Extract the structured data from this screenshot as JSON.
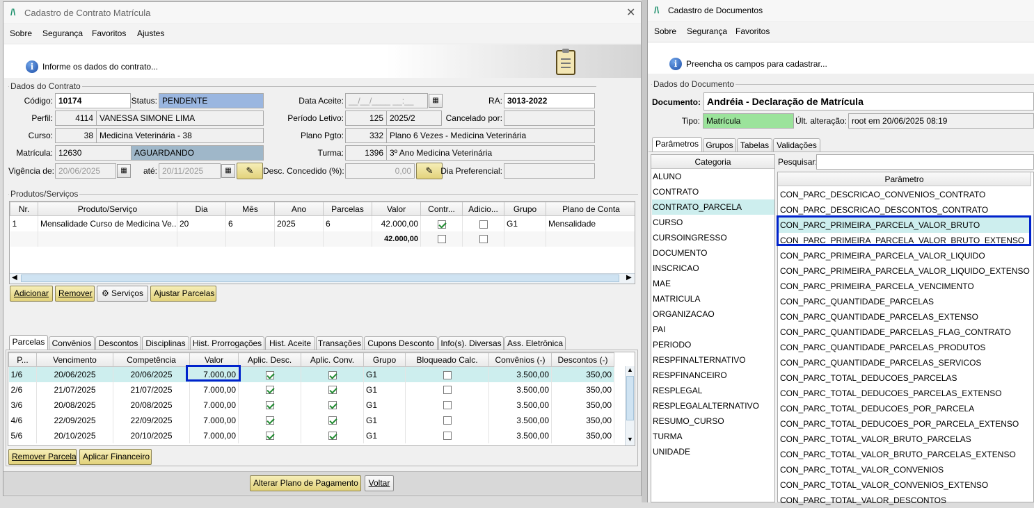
{
  "left_window": {
    "title": "Cadastro de Contrato Matrícula",
    "menu": [
      "Sobre",
      "Segurança",
      "Favoritos",
      "Ajustes"
    ],
    "info_text": "Informe os dados do contrato...",
    "section_contract": "Dados do Contrato",
    "labels": {
      "codigo": "Código:",
      "status": "Status:",
      "data_aceite": "Data Aceite:",
      "ra": "RA:",
      "perfil": "Perfil:",
      "periodo": "Período Letivo:",
      "cancelado": "Cancelado por:",
      "curso": "Curso:",
      "plano": "Plano Pgto:",
      "matricula": "Matrícula:",
      "turma": "Turma:",
      "vigencia": "Vigência de:",
      "ate": "até:",
      "desc": "Desc. Concedido (%):",
      "dia_pref": "Dia Preferencial:"
    },
    "values": {
      "codigo": "10174",
      "status": "PENDENTE",
      "data_aceite": "__/__/____ __:__",
      "ra": "3013-2022",
      "perfil_id": "4114",
      "perfil_nome": "VANESSA SIMONE LIMA",
      "periodo_id": "125",
      "periodo_nome": "2025/2",
      "cancelado": "",
      "curso_id": "38",
      "curso_nome": "Medicina Veterinária - 38",
      "plano_id": "332",
      "plano_nome": "Plano 6 Vezes - Medicina Veterinária",
      "matricula_id": "12630",
      "matricula_status": "AGUARDANDO",
      "turma_id": "1396",
      "turma_nome": "3º Ano Medicina Veterinária",
      "vigencia_de": "20/06/2025",
      "vigencia_ate": "20/11/2025",
      "desc": "0,00",
      "dia_pref": ""
    },
    "section_products": "Produtos/Serviços",
    "products_headers": [
      "Nr.",
      "Produto/Serviço",
      "Dia",
      "Mês",
      "Ano",
      "Parcelas",
      "Valor",
      "Contr...",
      "Adicio...",
      "Grupo",
      "Plano de Conta"
    ],
    "products_rows": [
      {
        "nr": "1",
        "produto": "Mensalidade Curso de Medicina Ve...",
        "dia": "20",
        "mes": "6",
        "ano": "2025",
        "parcelas": "6",
        "valor": "42.000,00",
        "contr": true,
        "adic": false,
        "grupo": "G1",
        "plano": "Mensalidade"
      }
    ],
    "products_total": "42.000,00",
    "product_buttons": [
      "Adicionar",
      "Remover",
      "Serviços",
      "Ajustar Parcelas"
    ],
    "tabs": [
      "Parcelas",
      "Convênios",
      "Descontos",
      "Disciplinas",
      "Hist. Prorrogações",
      "Hist. Aceite",
      "Transações",
      "Cupons Desconto",
      "Info(s). Diversas",
      "Ass. Eletrônica"
    ],
    "parcel_headers": [
      "P...",
      "Vencimento",
      "Competência",
      "Valor",
      "Aplic. Desc.",
      "Aplic. Conv.",
      "Grupo",
      "Bloqueado Calc.",
      "Convênios (-)",
      "Descontos (-)"
    ],
    "parcel_rows": [
      {
        "p": "1/6",
        "venc": "20/06/2025",
        "comp": "20/06/2025",
        "valor": "7.000,00",
        "desc": true,
        "conv": true,
        "grupo": "G1",
        "bloq": false,
        "convenios": "3.500,00",
        "descontos": "350,00"
      },
      {
        "p": "2/6",
        "venc": "21/07/2025",
        "comp": "21/07/2025",
        "valor": "7.000,00",
        "desc": true,
        "conv": true,
        "grupo": "G1",
        "bloq": false,
        "convenios": "3.500,00",
        "descontos": "350,00"
      },
      {
        "p": "3/6",
        "venc": "20/08/2025",
        "comp": "20/08/2025",
        "valor": "7.000,00",
        "desc": true,
        "conv": true,
        "grupo": "G1",
        "bloq": false,
        "convenios": "3.500,00",
        "descontos": "350,00"
      },
      {
        "p": "4/6",
        "venc": "22/09/2025",
        "comp": "22/09/2025",
        "valor": "7.000,00",
        "desc": true,
        "conv": true,
        "grupo": "G1",
        "bloq": false,
        "convenios": "3.500,00",
        "descontos": "350,00"
      },
      {
        "p": "5/6",
        "venc": "20/10/2025",
        "comp": "20/10/2025",
        "valor": "7.000,00",
        "desc": true,
        "conv": true,
        "grupo": "G1",
        "bloq": false,
        "convenios": "3.500,00",
        "descontos": "350,00"
      }
    ],
    "parcel_buttons": [
      "Remover Parcela",
      "Aplicar Financeiro"
    ],
    "footer_buttons": [
      "Alterar Plano de Pagamento",
      "Voltar"
    ]
  },
  "right_window": {
    "title": "Cadastro de Documentos",
    "menu": [
      "Sobre",
      "Segurança",
      "Favoritos"
    ],
    "info_text": "Preencha os campos para cadastrar...",
    "section": "Dados do Documento",
    "documento_label": "Documento:",
    "documento_value": "Andréia - Declaração de Matrícula",
    "tipo_label": "Tipo:",
    "tipo_value": "Matrícula",
    "ult_label": "Últ. alteração:",
    "ult_value": "root em 20/06/2025 08:19",
    "tabs": [
      "Parâmetros",
      "Grupos",
      "Tabelas",
      "Validações"
    ],
    "categoria_header": "Categoria",
    "pesquisar_label": "Pesquisar:",
    "parametro_header": "Parâmetro",
    "categories": [
      "ALUNO",
      "CONTRATO",
      "CONTRATO_PARCELA",
      "CURSO",
      "CURSOINGRESSO",
      "DOCUMENTO",
      "INSCRICAO",
      "MAE",
      "MATRICULA",
      "ORGANIZACAO",
      "PAI",
      "PERIODO",
      "RESPFINALTERNATIVO",
      "RESPFINANCEIRO",
      "RESPLEGAL",
      "RESPLEGALALTERNATIVO",
      "RESUMO_CURSO",
      "TURMA",
      "UNIDADE"
    ],
    "selected_category": "CONTRATO_PARCELA",
    "parameters": [
      "CON_PARC_DESCRICAO_CONVENIOS_CONTRATO",
      "CON_PARC_DESCRICAO_DESCONTOS_CONTRATO",
      "CON_PARC_PRIMEIRA_PARCELA_VALOR_BRUTO",
      "CON_PARC_PRIMEIRA_PARCELA_VALOR_BRUTO_EXTENSO",
      "CON_PARC_PRIMEIRA_PARCELA_VALOR_LIQUIDO",
      "CON_PARC_PRIMEIRA_PARCELA_VALOR_LIQUIDO_EXTENSO",
      "CON_PARC_PRIMEIRA_PARCELA_VENCIMENTO",
      "CON_PARC_QUANTIDADE_PARCELAS",
      "CON_PARC_QUANTIDADE_PARCELAS_EXTENSO",
      "CON_PARC_QUANTIDADE_PARCELAS_FLAG_CONTRATO",
      "CON_PARC_QUANTIDADE_PARCELAS_PRODUTOS",
      "CON_PARC_QUANTIDADE_PARCELAS_SERVICOS",
      "CON_PARC_TOTAL_DEDUCOES_PARCELAS",
      "CON_PARC_TOTAL_DEDUCOES_PARCELAS_EXTENSO",
      "CON_PARC_TOTAL_DEDUCOES_POR_PARCELA",
      "CON_PARC_TOTAL_DEDUCOES_POR_PARCELA_EXTENSO",
      "CON_PARC_TOTAL_VALOR_BRUTO_PARCELAS",
      "CON_PARC_TOTAL_VALOR_BRUTO_PARCELAS_EXTENSO",
      "CON_PARC_TOTAL_VALOR_CONVENIOS",
      "CON_PARC_TOTAL_VALOR_CONVENIOS_EXTENSO",
      "CON_PARC_TOTAL_VALOR_DESCONTOS"
    ]
  },
  "colors": {
    "status_bg": "#9ab6e0",
    "matricula_status_bg": "#9fb7c9",
    "tipo_bg": "#9be39b",
    "selected_row": "#cdeeee",
    "highlight_box": "#0022cc",
    "button_gold": "#e8d98a"
  }
}
